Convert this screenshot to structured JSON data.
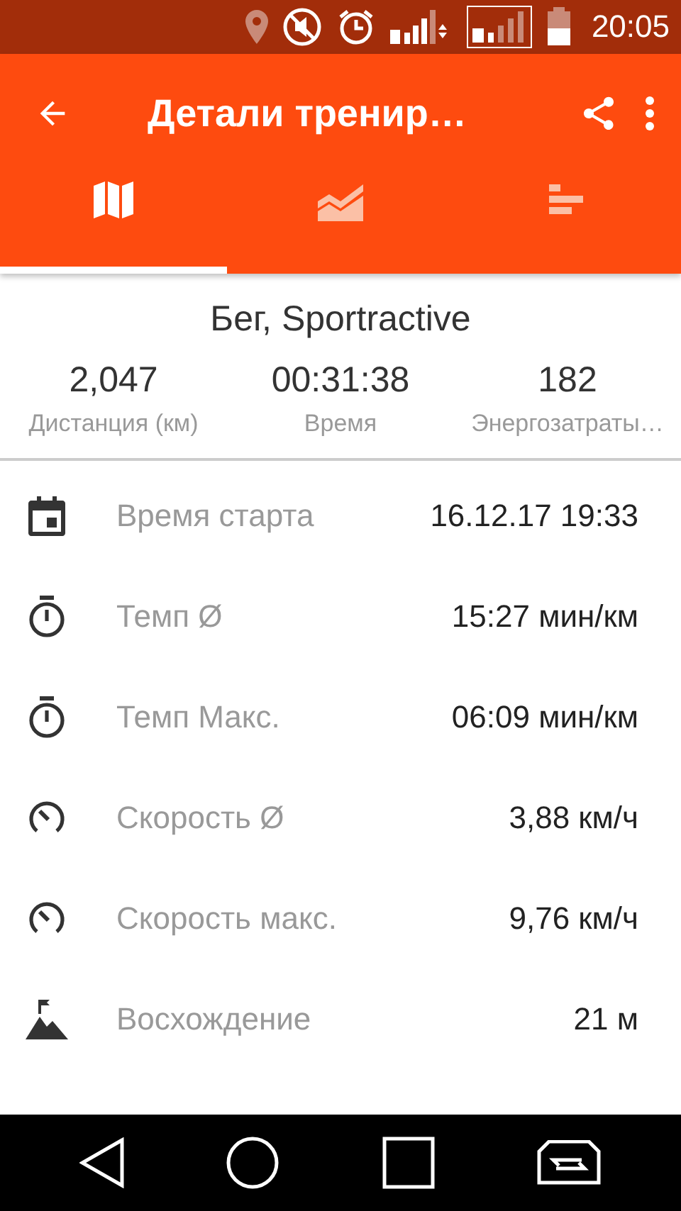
{
  "status_bar": {
    "time": "20:05"
  },
  "app_bar": {
    "title": "Детали тренир…"
  },
  "tabs": [
    {
      "kind": "map",
      "selected": true
    },
    {
      "kind": "chart",
      "selected": false
    },
    {
      "kind": "bars",
      "selected": false
    }
  ],
  "summary": {
    "title": "Бег, Sportractive",
    "stats": [
      {
        "value": "2,047",
        "label": "Дистанция (км)"
      },
      {
        "value": "00:31:38",
        "label": "Время"
      },
      {
        "value": "182",
        "label": "Энергозатраты…"
      }
    ]
  },
  "details": [
    {
      "kind": "calendar",
      "label": "Время старта",
      "value": "16.12.17 19:33"
    },
    {
      "kind": "stopwatch",
      "label": "Темп Ø",
      "value": "15:27 мин/км"
    },
    {
      "kind": "stopwatch",
      "label": "Темп Макс.",
      "value": "06:09 мин/км"
    },
    {
      "kind": "gauge",
      "label": "Скорость Ø",
      "value": "3,88 км/ч"
    },
    {
      "kind": "gauge",
      "label": "Скорость макс.",
      "value": "9,76 км/ч"
    },
    {
      "kind": "mountain",
      "label": "Восхождение",
      "value": "21 м"
    }
  ]
}
